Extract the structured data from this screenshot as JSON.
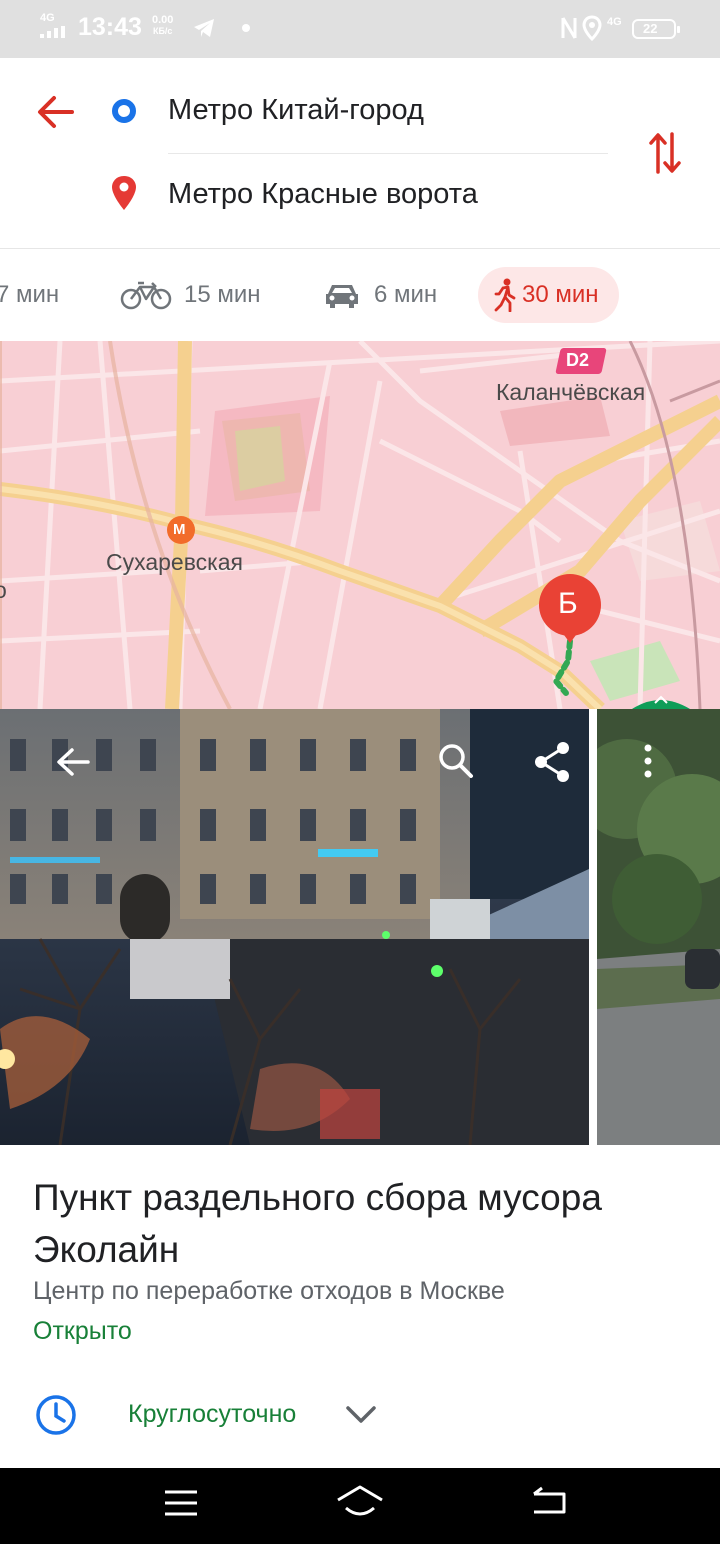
{
  "status_bar": {
    "network_left": "4G",
    "time": "13:43",
    "speed_value": "0.00",
    "speed_unit": "КБ/с",
    "network_right": "4G",
    "battery": "22"
  },
  "route": {
    "origin": "Метро Китай-город",
    "destination": "Метро Красные ворота"
  },
  "modes": [
    {
      "label": "7 мин",
      "icon": "transit-icon"
    },
    {
      "label": "15 мин",
      "icon": "bicycle-icon"
    },
    {
      "label": "6 мин",
      "icon": "car-icon"
    },
    {
      "label": "30 мин",
      "icon": "walk-icon",
      "selected": true
    }
  ],
  "map": {
    "station_1": "Сухаревская",
    "station_2": "Каланчёвская",
    "badge_d2": "D2",
    "destination_marker": "Б",
    "left_edge_label": "о",
    "metro_symbol": "М"
  },
  "place": {
    "title": "Пункт раздельного сбора мусора Эколайн",
    "category": "Центр по переработке отходов в Москве",
    "status": "Открыто",
    "hours": "Круглосуточно"
  },
  "colors": {
    "accent_red": "#d93025",
    "open_green": "#188038",
    "origin_blue": "#1a73e8",
    "clock_blue": "#1a73e8"
  }
}
